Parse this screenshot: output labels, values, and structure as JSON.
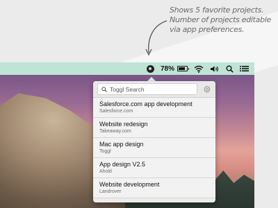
{
  "annotation": {
    "lines": [
      "Shows 5 favorite projects.",
      "Number of projects editable",
      "via app preferences."
    ]
  },
  "menubar": {
    "battery_percent_label": "78%",
    "battery_level": 0.78,
    "background_color": "#bfe3d5",
    "icons": [
      "toggl-app-icon",
      "battery-icon",
      "wifi-icon",
      "volume-icon",
      "search-icon",
      "menu-list-icon"
    ]
  },
  "popover": {
    "search": {
      "placeholder": "Toggl Search",
      "value": ""
    },
    "settings_icon": "gear-icon",
    "projects": [
      {
        "title": "Salesforce.com app development",
        "client": "Salesforce.com"
      },
      {
        "title": "Website redesign",
        "client": "Takeaway.com"
      },
      {
        "title": "Mac app design",
        "client": "Toggl"
      },
      {
        "title": "App design V2.5",
        "client": "Ahold"
      },
      {
        "title": "Website development",
        "client": "Landrover"
      }
    ]
  }
}
